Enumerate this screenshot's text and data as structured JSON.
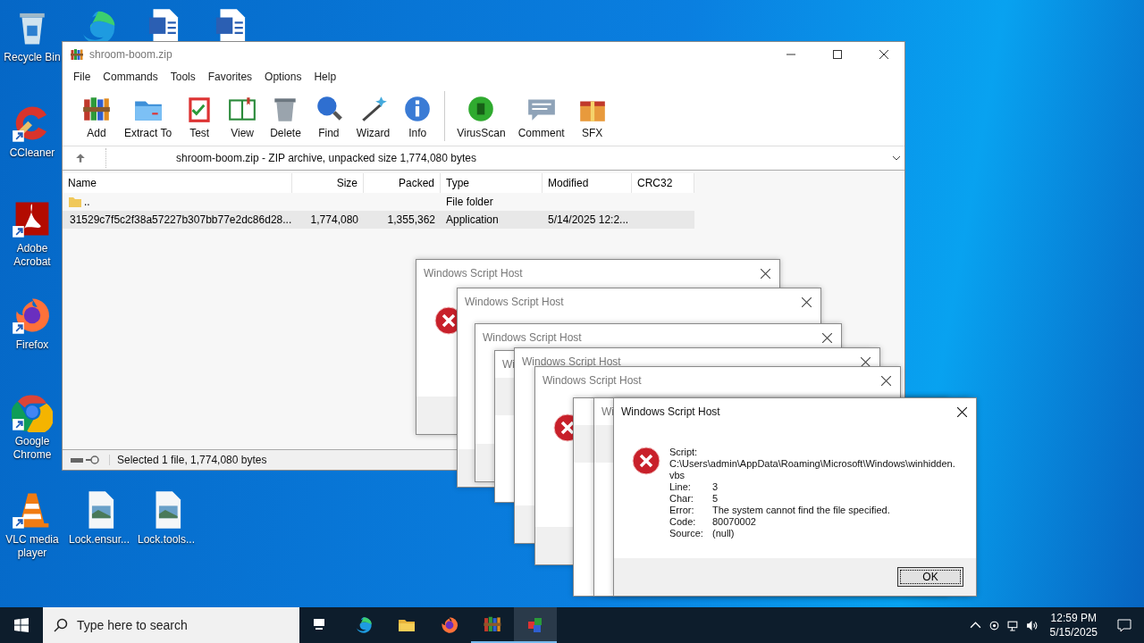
{
  "desktop_icons": [
    {
      "kind": "recycle",
      "label": "Recycle Bin",
      "shortcut": false
    },
    {
      "kind": "edge",
      "shortcut": false
    },
    {
      "kind": "word",
      "shortcut": false
    },
    {
      "kind": "word",
      "shortcut": false
    },
    {
      "kind": "ccleaner",
      "label": "CCleaner",
      "shortcut": true
    },
    {
      "kind": "acrobat",
      "label": "Adobe Acrobat",
      "shortcut": true
    },
    {
      "kind": "firefox",
      "label": "Firefox",
      "shortcut": true
    },
    {
      "kind": "chrome",
      "label": "Google Chrome",
      "shortcut": true
    },
    {
      "kind": "vlc",
      "label": "VLC media player",
      "shortcut": true
    },
    {
      "kind": "image",
      "label": "Lock.ensur...",
      "shortcut": false
    },
    {
      "kind": "image",
      "label": "Lock.tools...",
      "shortcut": false
    }
  ],
  "archive_window": {
    "title": "shroom-boom.zip",
    "menu": [
      "File",
      "Commands",
      "Tools",
      "Favorites",
      "Options",
      "Help"
    ],
    "toolbar_groups": [
      [
        "Add",
        "Extract To",
        "Test",
        "View",
        "Delete",
        "Find",
        "Wizard",
        "Info"
      ],
      [
        "VirusScan",
        "Comment",
        "SFX"
      ]
    ],
    "address": "shroom-boom.zip - ZIP archive, unpacked size 1,774,080 bytes",
    "columns": [
      "Name",
      "Size",
      "Packed",
      "Type",
      "Modified",
      "CRC32"
    ],
    "rows": [
      {
        "kind": "folder",
        "name": "..",
        "size": "",
        "packed": "",
        "type": "File folder",
        "modified": "",
        "selected": false
      },
      {
        "kind": "app",
        "name": "31529c7f5c2f38a57227b307bb77e2dc86d28...",
        "size": "1,774,080",
        "packed": "1,355,362",
        "type": "Application",
        "modified": "5/14/2025 12:2...",
        "selected": true
      }
    ],
    "status": "Selected 1 file, 1,774,080 bytes"
  },
  "dialogs": [
    {
      "kind": "full",
      "title": "Windows Script Host",
      "error_icon": true
    },
    {
      "kind": "full",
      "title": "Windows Script Host",
      "error_icon": false
    },
    {
      "kind": "full",
      "title": "Windows Script Host",
      "error_icon": false
    },
    {
      "kind": "edge",
      "title": "Wi"
    },
    {
      "kind": "full",
      "title": "Windows Script Host",
      "error_icon": false
    },
    {
      "kind": "full",
      "title": "Windows Script Host",
      "error_icon": true
    },
    {
      "kind": "edge"
    },
    {
      "kind": "edge",
      "title": "Wi"
    }
  ],
  "error_dialog": {
    "title": "Windows Script Host",
    "fields": [
      {
        "kind": "stacked",
        "label": "Script:",
        "value": "C:\\Users\\admin\\AppData\\Roaming\\Microsoft\\Windows\\winhidden.vbs"
      },
      {
        "kind": "row",
        "label": "Line:",
        "value": "3"
      },
      {
        "kind": "row",
        "label": "Char:",
        "value": "5"
      },
      {
        "kind": "row",
        "label": "Error:",
        "value": "The system cannot find the file specified."
      },
      {
        "kind": "row",
        "label": "Code:",
        "value": "80070002"
      },
      {
        "kind": "row",
        "label": "Source:",
        "value": "(null)"
      }
    ],
    "button": "OK"
  },
  "taskbar": {
    "search_placeholder": "Type here to search",
    "apps": [
      {
        "kind": "taskview",
        "running": false,
        "selected": false
      },
      {
        "kind": "edge",
        "running": false,
        "selected": false
      },
      {
        "kind": "explorer",
        "running": false,
        "selected": false
      },
      {
        "kind": "firefox",
        "running": false,
        "selected": false
      },
      {
        "kind": "winrar",
        "running": true,
        "selected": false
      },
      {
        "kind": "script",
        "running": true,
        "selected": true
      }
    ],
    "time": "12:59 PM",
    "date": "5/15/2025"
  }
}
